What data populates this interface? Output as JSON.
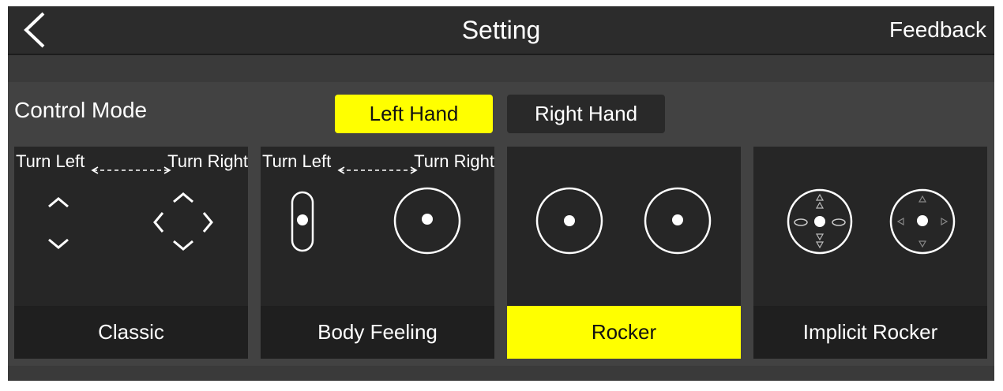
{
  "header": {
    "title": "Setting",
    "feedback_label": "Feedback",
    "back_icon": "chevron-left-icon"
  },
  "control_mode": {
    "label": "Control Mode",
    "hands": [
      {
        "label": "Left Hand",
        "selected": true
      },
      {
        "label": "Right Hand",
        "selected": false
      }
    ],
    "active_color": "#ffff00"
  },
  "modes": [
    {
      "label": "Classic",
      "selected": false,
      "turn_left": "Turn Left",
      "turn_right": "Turn Right"
    },
    {
      "label": "Body Feeling",
      "selected": false,
      "turn_left": "Turn Left",
      "turn_right": "Turn Right"
    },
    {
      "label": "Rocker",
      "selected": true
    },
    {
      "label": "Implicit Rocker",
      "selected": false
    }
  ]
}
